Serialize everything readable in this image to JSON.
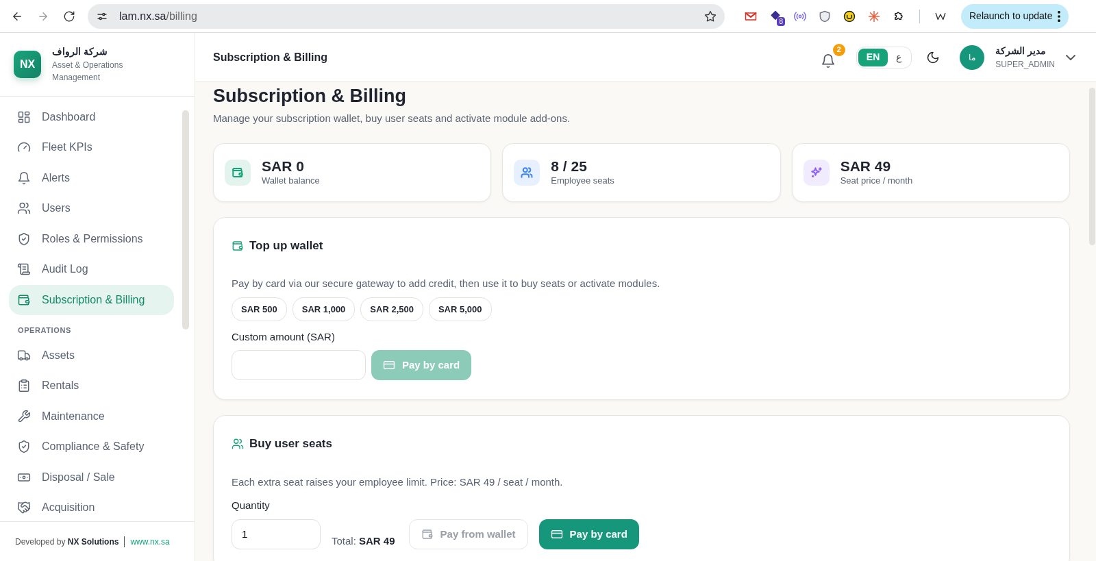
{
  "browser": {
    "url_host": "lam.nx.sa",
    "url_path": "/billing",
    "extension_badge": "8",
    "relaunch_label": "Relaunch to update"
  },
  "sidebar": {
    "brand": {
      "logo": "NX",
      "name": "شركة الرواف",
      "subtitle": "Asset & Operations Management"
    },
    "sections": [
      {
        "items": [
          {
            "label": "Dashboard",
            "selected": false
          },
          {
            "label": "Fleet KPIs",
            "selected": false
          },
          {
            "label": "Alerts",
            "selected": false
          },
          {
            "label": "Users",
            "selected": false
          },
          {
            "label": "Roles & Permissions",
            "selected": false
          },
          {
            "label": "Audit Log",
            "selected": false
          },
          {
            "label": "Subscription & Billing",
            "selected": true
          }
        ]
      },
      {
        "title": "OPERATIONS",
        "items": [
          {
            "label": "Assets",
            "selected": false
          },
          {
            "label": "Rentals",
            "selected": false
          },
          {
            "label": "Maintenance",
            "selected": false
          },
          {
            "label": "Compliance & Safety",
            "selected": false
          },
          {
            "label": "Disposal / Sale",
            "selected": false
          },
          {
            "label": "Acquisition",
            "selected": false
          }
        ]
      }
    ],
    "footer": {
      "prefix": "Developed by",
      "company": "NX Solutions",
      "link": "www.nx.sa"
    }
  },
  "header": {
    "title": "Subscription & Billing",
    "notification_count": "2",
    "languages": [
      {
        "label": "EN",
        "selected": true
      },
      {
        "label": "ع",
        "selected": false
      }
    ],
    "user": {
      "initials": "ما",
      "name": "مدير الشركة",
      "role": "SUPER_ADMIN"
    }
  },
  "page": {
    "title": "Subscription & Billing",
    "subtitle": "Manage your subscription wallet, buy user seats and activate module add-ons.",
    "stats": [
      {
        "value": "SAR 0",
        "label": "Wallet balance",
        "color": "#16a37a"
      },
      {
        "value": "8 / 25",
        "label": "Employee seats",
        "color": "#3b82f6"
      },
      {
        "value": "SAR 49",
        "label": "Seat price / month",
        "color": "#8b5cf6"
      }
    ],
    "top_up": {
      "title": "Top up wallet",
      "description": "Pay by card via our secure gateway to add credit, then use it to buy seats or activate modules.",
      "presets": [
        "SAR 500",
        "SAR 1,000",
        "SAR 2,500",
        "SAR 5,000"
      ],
      "custom_label": "Custom amount (SAR)",
      "pay_button": {
        "label": "Pay by card",
        "disabled": true
      }
    },
    "seats": {
      "title": "Buy user seats",
      "description": "Each extra seat raises your employee limit. Price: SAR 49 / seat / month.",
      "quantity_label": "Quantity",
      "quantity_value": "1",
      "total_label": "Total:",
      "total_value": "SAR 49",
      "wallet_button": {
        "label": "Pay from wallet",
        "disabled": true
      },
      "card_button": {
        "label": "Pay by card",
        "disabled": false
      }
    }
  }
}
